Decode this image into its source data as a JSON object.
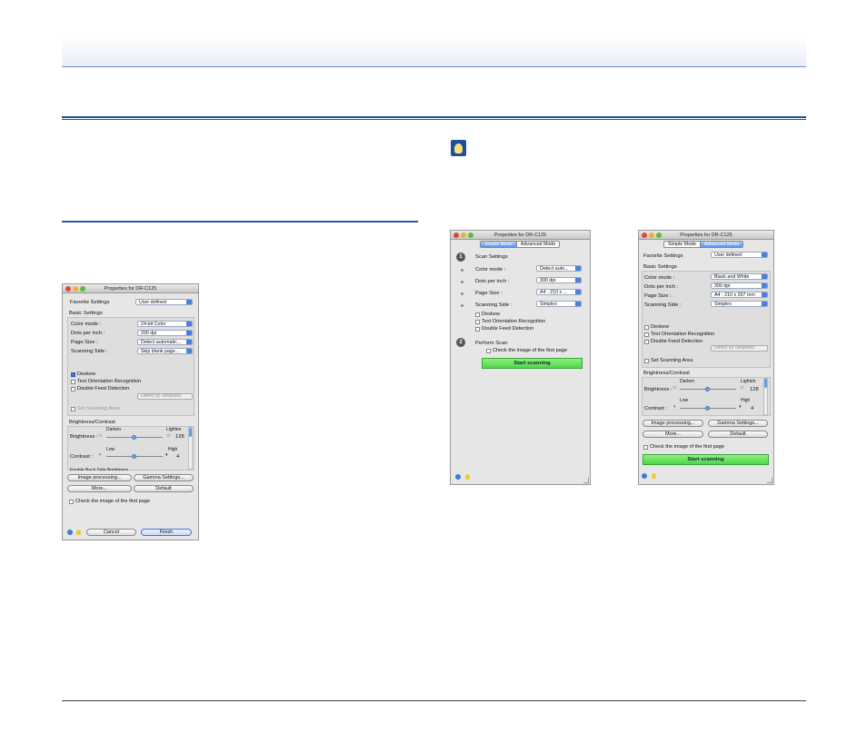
{
  "window_left": {
    "title": "Properties for DR-C125",
    "favorite_label": "Favorite Settings",
    "favorite_value": "User defined",
    "basic_settings": "Basic Settings",
    "color_mode_label": "Color mode :",
    "color_mode_value": "24-bit Color",
    "dpi_label": "Dots per inch :",
    "dpi_value": "200 dpi",
    "page_size_label": "Page Size :",
    "page_size_value": "Detect automatic...",
    "side_label": "Scanning Side :",
    "side_value": "Skip blank page...",
    "deskew": "Deskew",
    "text_orientation": "Text Orientation Recognition",
    "double_feed": "Double Feed Detection",
    "detect_ultrasonic": "Detect by Ultrasonic",
    "set_area": "Set Scanning Area",
    "brightness_contrast": "Brightness/Contrast",
    "darken": "Darken",
    "lighten": "Lighten",
    "brightness_label": "Brightness :",
    "brightness_value": "128",
    "low": "Low",
    "high": "High",
    "contrast_label": "Contrast :",
    "contrast_value": "4",
    "enable_back": "Enable Back Side Brightness",
    "image_processing": "Image processing...",
    "gamma": "Gamma Settings...",
    "more": "More...",
    "default": "Default",
    "check_first": "Check the image of the first page",
    "cancel": "Cancel",
    "finish": "Finish"
  },
  "window_mid": {
    "title": "Properties for DR-C125",
    "tab_simple": "Simple Mode",
    "tab_advanced": "Advanced Mode",
    "step1": "1",
    "scan_settings": "Scan Settings",
    "color_mode_label": "Color mode :",
    "color_mode_value": "Detect auto...",
    "dpi_label": "Dots per inch :",
    "dpi_value": "300 dpi",
    "page_size_label": "Page Size :",
    "page_size_value": "A4 - 210 x ...",
    "side_label": "Scanning Side :",
    "side_value": "Simplex",
    "deskew": "Deskew",
    "text_orientation": "Text Orientation Recognition",
    "double_feed": "Double Feed Detection",
    "step2": "2",
    "perform_scan": "Perform Scan",
    "check_first": "Check the image of the first page",
    "start": "Start scanning"
  },
  "window_right": {
    "title": "Properties for DR-C125",
    "tab_simple": "Simple Mode",
    "tab_advanced": "Advanced Mode",
    "favorite_label": "Favorite Settings",
    "favorite_value": "User defined",
    "basic_settings": "Basic Settings",
    "color_mode_label": "Color mode :",
    "color_mode_value": "Black and White",
    "dpi_label": "Dots per inch :",
    "dpi_value": "300 dpi",
    "page_size_label": "Page Size :",
    "page_size_value": "A4 - 210 x 297 mm",
    "side_label": "Scanning Side :",
    "side_value": "Simplex",
    "deskew": "Deskew",
    "text_orientation": "Text Orientation Recognition",
    "double_feed": "Double Feed Detection",
    "detect_ultrasonic": "Detect by Ultrasonic",
    "set_area": "Set Scanning Area",
    "brightness_contrast": "Brightness/Contrast",
    "darken": "Darken",
    "lighten": "Lighten",
    "brightness_label": "Brightness :",
    "brightness_value": "128",
    "low": "Low",
    "high": "High",
    "contrast_label": "Contrast :",
    "contrast_value": "4",
    "image_processing": "Image processing...",
    "gamma": "Gamma Settings...",
    "more": "More...",
    "default": "Default",
    "check_first": "Check the image of the first page",
    "start": "Start scanning"
  },
  "colors": {
    "rule_blue": "#1f4e9a",
    "hint_blue": "#1e4f98",
    "start_green": "#4fd64a"
  }
}
